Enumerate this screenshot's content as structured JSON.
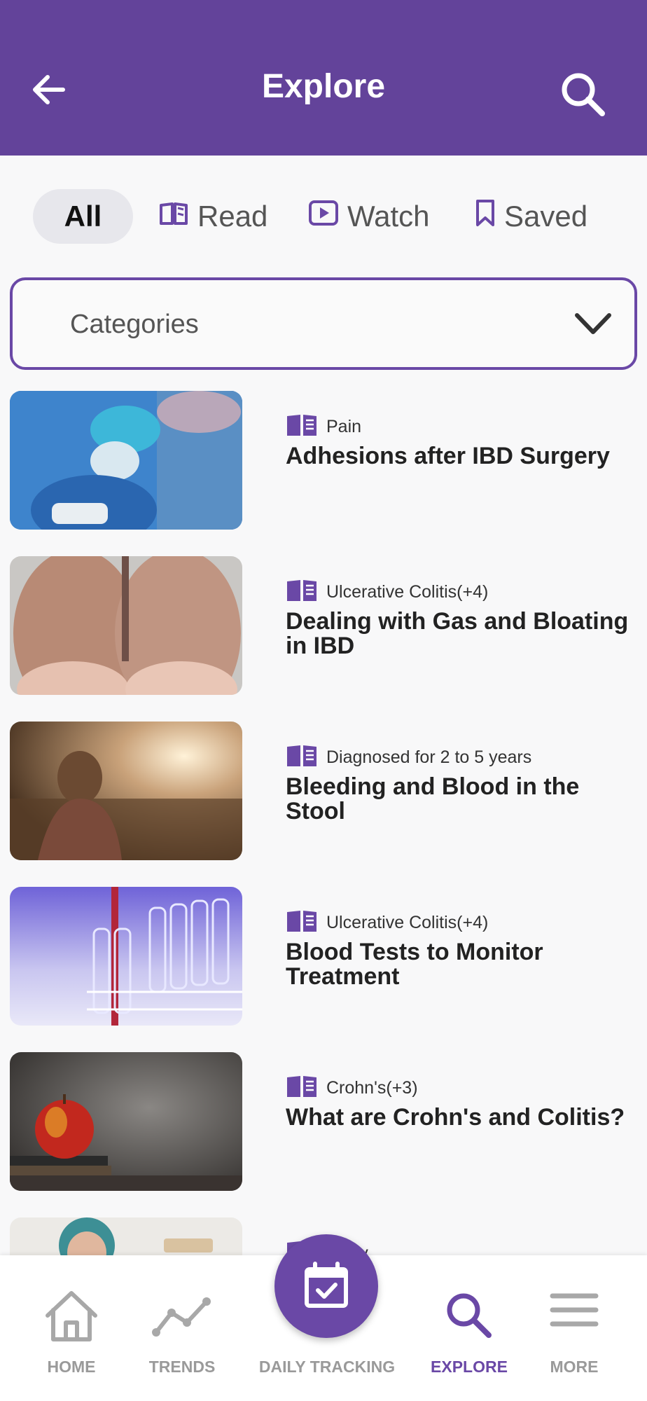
{
  "header": {
    "title": "Explore"
  },
  "filters": {
    "all": "All",
    "read": "Read",
    "watch": "Watch",
    "saved": "Saved"
  },
  "categories": {
    "label": "Categories"
  },
  "articles": [
    {
      "category": "Pain",
      "title": "Adhesions after IBD Surgery"
    },
    {
      "category": "Ulcerative Colitis(+4)",
      "title": "Dealing with Gas and Bloating in IBD"
    },
    {
      "category": "Diagnosed for 2 to 5 years",
      "title": "Bleeding and Blood in the Stool"
    },
    {
      "category": "Ulcerative Colitis(+4)",
      "title": "Blood Tests to Monitor Treatment"
    },
    {
      "category": "Crohn's(+3)",
      "title": "What are Crohn's and Colitis?"
    },
    {
      "category": "…rgy",
      "title": ""
    }
  ],
  "nav": {
    "home": "HOME",
    "trends": "TRENDS",
    "daily_tracking": "DAILY TRACKING",
    "explore": "EXPLORE",
    "more": "MORE"
  },
  "colors": {
    "primary": "#63439a",
    "accent": "#6a48a6",
    "inactive": "#9a9a9a"
  }
}
